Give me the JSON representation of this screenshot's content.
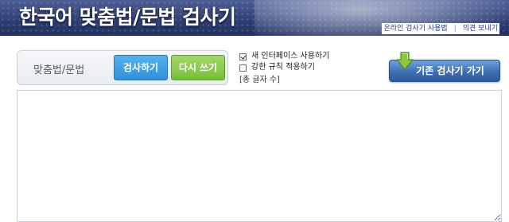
{
  "header": {
    "logo_text": "한국어 맞춤법/문법 검사기",
    "links": [
      "온라인 검사기 사용법",
      "의견 보내기"
    ],
    "link_separator": "|"
  },
  "toolbar": {
    "label": "맞춤법/문법",
    "check_button": "검사하기",
    "reset_button": "다시 쓰기",
    "old_checker_button": "기존 검사기 가기"
  },
  "options": [
    {
      "label": "새 인터페이스 사용하기",
      "checked": true
    },
    {
      "label": "강한 규칙 적용하기",
      "checked": false
    }
  ],
  "char_count_text": "[총 글자 수]",
  "editor": {
    "value": ""
  },
  "colors": {
    "banner": "#2f3f75",
    "check_button": "#2f8fd8",
    "reset_button": "#78be3a",
    "old_button": "#3e6fb3",
    "arrow": "#8cc63f"
  },
  "icons": {
    "old_checker": "green-down-arrow-icon"
  }
}
